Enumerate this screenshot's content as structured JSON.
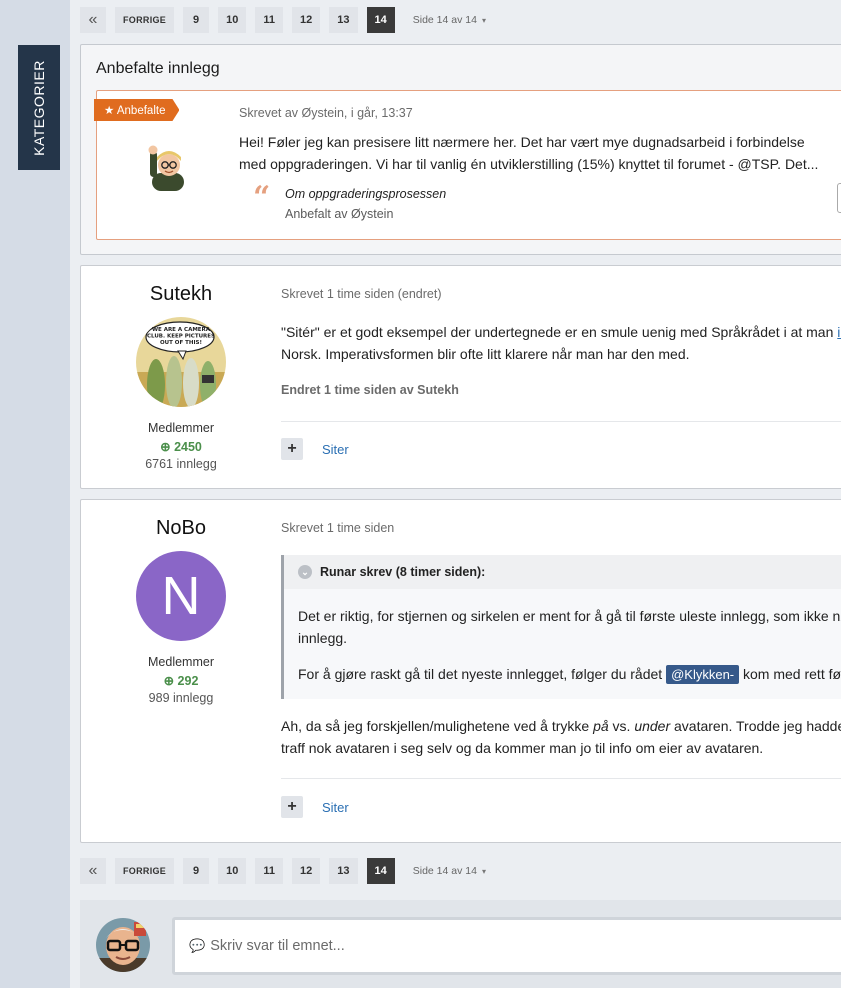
{
  "sidebar": {
    "tab_label": "KATEGORIER"
  },
  "pagination": {
    "first_icon": "double-chevron-left-icon",
    "first_glyph": "«",
    "prev_label": "FORRIGE",
    "pages": [
      "9",
      "10",
      "11",
      "12",
      "13",
      "14"
    ],
    "active_page": "14",
    "page_info": "Side 14 av 14",
    "caret": "▾"
  },
  "recommended": {
    "title": "Anbefalte innlegg",
    "badge": "★ Anbefalte",
    "meta": "Skrevet av Øystein, i går, 13:37",
    "text_line1": "Hei! Føler jeg kan presisere litt nærmere her. Det har vært mye dugnadsarbeid i forbindelse",
    "text_line2": "med oppgraderingen. Vi har til vanlig én utviklerstilling (15%) knyttet til forumet - @TSP. Det...",
    "quote_glyph": "“",
    "quote_title": "Om oppgraderingsprosessen",
    "quote_by": "Anbefalt av Øystein"
  },
  "posts": [
    {
      "username": "Sutekh",
      "avatar_text": "WE ARE A CAMERA CLUB. KEEP PICTURES OUT OF THIS!",
      "group": "Medlemmer",
      "reputation": "2450",
      "post_count": "6761 innlegg",
      "meta": "Skrevet 1 time siden (endret)",
      "line1_before": "\"Sitér\" er et godt eksempel der undertegnede er en smule uenig med Språkrådet i at man ",
      "line1_link": "ikke",
      "line2": "Norsk. Imperativsformen blir ofte litt klarere når man har den med.",
      "edited": "Endret 1 time siden av Sutekh",
      "plus": "+",
      "quote_action": "Siter"
    },
    {
      "username": "NoBo",
      "avatar_letter": "N",
      "group": "Medlemmer",
      "reputation": "292",
      "post_count": "989 innlegg",
      "meta": "Skrevet 1 time siden",
      "quote_header": "Runar skrev (8 timer siden):",
      "quote_line1": "Det er riktig, for stjernen og sirkelen er ment for å gå til første uleste innlegg, som ikke nø",
      "quote_line2": "innlegg.",
      "quote_line3_before": "For å gjøre raskt gå til det nyeste innlegget, følger du rådet ",
      "quote_mention": "@Klykken-",
      "quote_line3_after": " kom med rett før",
      "body_p1": "Ah, da så jeg forskjellen/mulighetene ved å trykke ",
      "body_em1": "på",
      "body_p2": " vs. ",
      "body_em2": "under",
      "body_p3": " avataren. Trodde jeg hadde",
      "body_line2": "traff nok avataren i seg selv og da kommer man jo til info om eier av avataren.",
      "plus": "+",
      "quote_action": "Siter"
    }
  ],
  "reply": {
    "placeholder": "Skriv svar til emnet...",
    "icon": "speech-bubble-icon",
    "bubble_glyph": "💬"
  },
  "colors": {
    "navy": "#243549",
    "accent_orange": "#e06c1f",
    "link_blue": "#2a6fb3",
    "rep_green": "#4b8f4b",
    "avatar_purple": "#8a66c7"
  }
}
